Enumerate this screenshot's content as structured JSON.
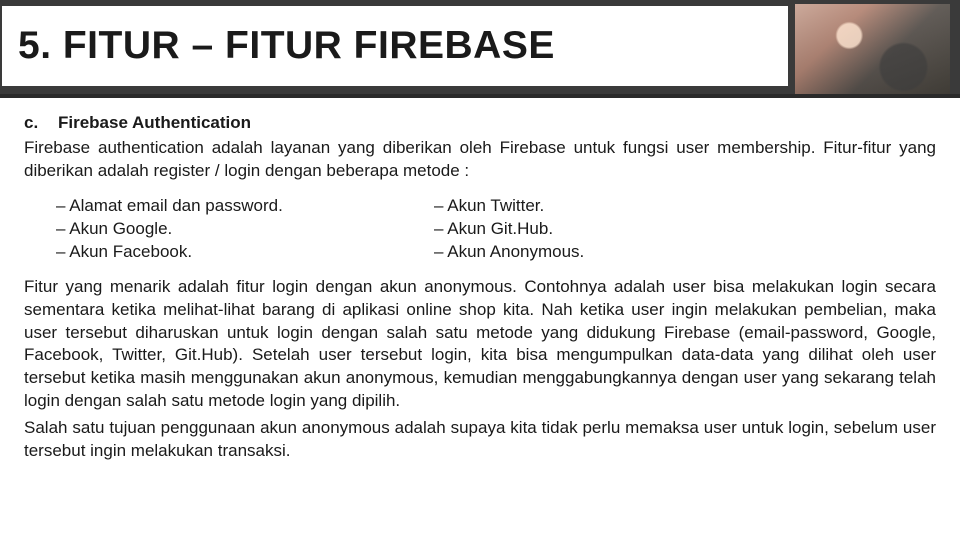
{
  "header": {
    "title": "5.  FITUR – FITUR FIREBASE"
  },
  "section": {
    "letter": "c.",
    "heading": "Firebase Authentication",
    "intro": "Firebase authentication adalah layanan yang diberikan oleh Firebase untuk fungsi user membership. Fitur-fitur yang diberikan adalah register / login dengan beberapa metode :"
  },
  "bullets": {
    "left": [
      "– Alamat email dan password.",
      "– Akun Google.",
      "– Akun Facebook."
    ],
    "right": [
      "– Akun Twitter.",
      "– Akun Git.Hub.",
      "– Akun Anonymous."
    ]
  },
  "para1": "Fitur yang menarik adalah fitur login dengan akun anonymous. Contohnya adalah user bisa melakukan login secara sementara ketika melihat-lihat barang di aplikasi online shop kita. Nah ketika user ingin melakukan pembelian, maka user tersebut diharuskan untuk login dengan salah satu metode yang didukung Firebase (email-password, Google, Facebook, Twitter, Git.Hub). Setelah user tersebut login, kita bisa mengumpulkan data-data yang dilihat oleh user tersebut ketika masih menggunakan akun anonymous, kemudian menggabungkannya dengan user yang sekarang telah login dengan salah satu metode login yang dipilih.",
  "para2": "Salah satu tujuan penggunaan akun anonymous adalah supaya kita tidak perlu memaksa user untuk login, sebelum user tersebut ingin melakukan transaksi."
}
